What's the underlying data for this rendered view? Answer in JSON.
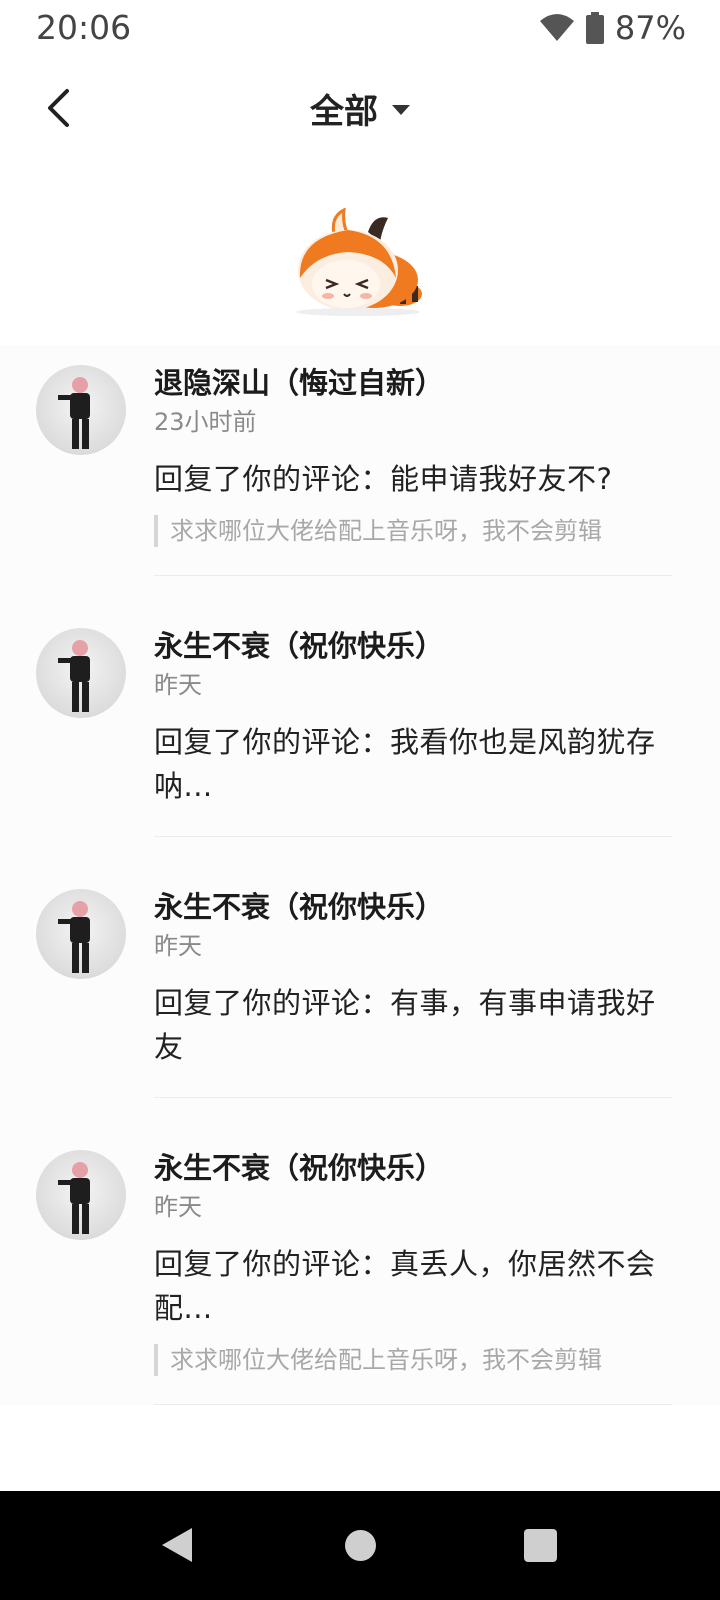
{
  "status_bar": {
    "time": "20:06",
    "battery": "87%",
    "icons": [
      "wifi-icon",
      "battery-icon"
    ]
  },
  "header": {
    "title": "全部",
    "back_icon": "chevron-left-icon",
    "dropdown_icon": "caret-down-icon"
  },
  "colors": {
    "text_primary": "#222222",
    "text_secondary": "#8a8a8a",
    "quote_text": "#a8a8a8",
    "mascot_orange": "#f07a1f",
    "nav_bar": "#000000"
  },
  "notifications": [
    {
      "user": "退隐深山（悔过自新）",
      "time": "23小时前",
      "content": "回复了你的评论：能申请我好友不?",
      "quote": "求求哪位大佬给配上音乐呀，我不会剪辑"
    },
    {
      "user": "永生不衰（祝你快乐）",
      "time": "昨天",
      "content": "回复了你的评论：我看你也是风韵犹存呐...",
      "quote": null
    },
    {
      "user": "永生不衰（祝你快乐）",
      "time": "昨天",
      "content": "回复了你的评论：有事，有事申请我好友",
      "quote": null
    },
    {
      "user": "永生不衰（祝你快乐）",
      "time": "昨天",
      "content": "回复了你的评论：真丢人，你居然不会配...",
      "quote": "求求哪位大佬给配上音乐呀，我不会剪辑"
    }
  ],
  "nav_bar": {
    "icons": [
      "nav-back-icon",
      "nav-home-icon",
      "nav-recents-icon"
    ]
  }
}
